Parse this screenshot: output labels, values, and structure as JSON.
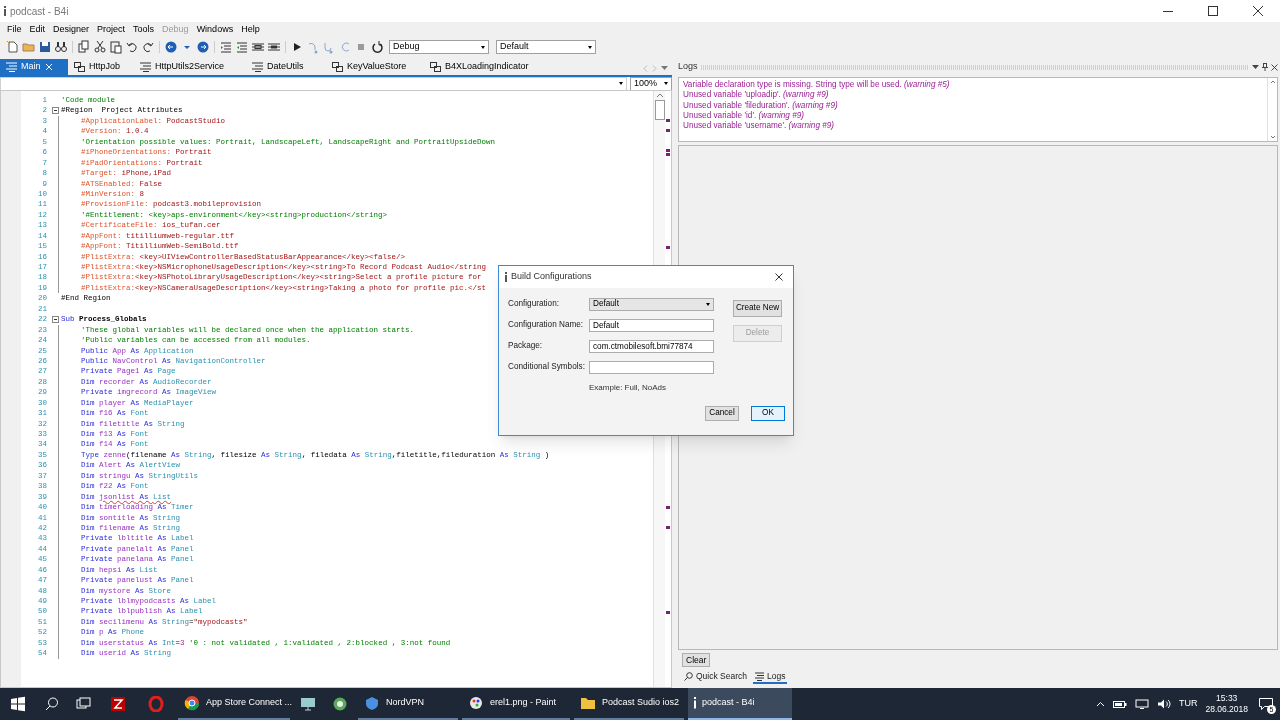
{
  "window": {
    "title": "podcast - B4i"
  },
  "menu": [
    {
      "label": "File",
      "disabled": false
    },
    {
      "label": "Edit",
      "disabled": false
    },
    {
      "label": "Designer",
      "disabled": false
    },
    {
      "label": "Project",
      "disabled": false
    },
    {
      "label": "Tools",
      "disabled": false
    },
    {
      "label": "Debug",
      "disabled": true
    },
    {
      "label": "Windows",
      "disabled": false
    },
    {
      "label": "Help",
      "disabled": false
    }
  ],
  "toolbar": {
    "build_mode": "Debug",
    "configuration": "Default"
  },
  "tabs": [
    {
      "label": "Main",
      "kind": "module",
      "selected": true
    },
    {
      "label": "HttpJob",
      "kind": "class",
      "selected": false
    },
    {
      "label": "HttpUtils2Service",
      "kind": "module",
      "selected": false
    },
    {
      "label": "DateUtils",
      "kind": "module",
      "selected": false
    },
    {
      "label": "KeyValueStore",
      "kind": "class",
      "selected": false
    },
    {
      "label": "B4XLoadingIndicator",
      "kind": "class",
      "selected": false
    }
  ],
  "editor": {
    "zoom": "100%",
    "lines": [
      {
        "number": "1",
        "tokens": [
          {
            "kind": "comment",
            "text": "'Code module"
          }
        ]
      },
      {
        "number": "2",
        "tokens": [
          {
            "kind": "plain",
            "text": "#Region  Project Attributes"
          }
        ],
        "children": [
          {
            "number": "3",
            "tokens": [
              {
                "kind": "directive",
                "text": "#ApplicationLabel:"
              },
              {
                "kind": "value",
                "text": " PodcastStudio"
              }
            ]
          },
          {
            "number": "4",
            "tokens": [
              {
                "kind": "directive",
                "text": "#Version:"
              },
              {
                "kind": "value",
                "text": " 1.0.4"
              }
            ]
          },
          {
            "number": "5",
            "tokens": [
              {
                "kind": "comment",
                "text": "'Orientation possible values: Portrait, LandscapeLeft, LandscapeRight and PortraitUpsideDown"
              }
            ]
          },
          {
            "number": "6",
            "tokens": [
              {
                "kind": "directive",
                "text": "#iPhoneOrientations:"
              },
              {
                "kind": "value",
                "text": " Portrait"
              }
            ]
          },
          {
            "number": "7",
            "tokens": [
              {
                "kind": "directive",
                "text": "#iPadOrientations:"
              },
              {
                "kind": "value",
                "text": " Portrait"
              }
            ]
          },
          {
            "number": "8",
            "tokens": [
              {
                "kind": "directive",
                "text": "#Target:"
              },
              {
                "kind": "value",
                "text": " iPhone,iPad"
              }
            ]
          },
          {
            "number": "9",
            "tokens": [
              {
                "kind": "directive",
                "text": "#ATSEnabled:"
              },
              {
                "kind": "value",
                "text": " False"
              }
            ]
          },
          {
            "number": "10",
            "tokens": [
              {
                "kind": "directive",
                "text": "#MinVersion:"
              },
              {
                "kind": "value",
                "text": " 8"
              }
            ]
          },
          {
            "number": "11",
            "tokens": [
              {
                "kind": "directive",
                "text": "#ProvisionFile:"
              },
              {
                "kind": "value",
                "text": " podcast3.mobileprovision"
              }
            ]
          },
          {
            "number": "12",
            "tokens": [
              {
                "kind": "comment",
                "text": "'#Entitlement: <key>aps-environment</key><string>production</string>"
              }
            ]
          },
          {
            "number": "13",
            "tokens": [
              {
                "kind": "directive",
                "text": "#CertificateFile:"
              },
              {
                "kind": "value",
                "text": " ios_tufan.cer"
              }
            ]
          },
          {
            "number": "14",
            "tokens": [
              {
                "kind": "directive",
                "text": "#AppFont:"
              },
              {
                "kind": "value",
                "text": " titilliumweb-regular.ttf"
              }
            ]
          },
          {
            "number": "15",
            "tokens": [
              {
                "kind": "directive",
                "text": "#AppFont:"
              },
              {
                "kind": "value",
                "text": " TitilliumWeb-SemiBold.ttf"
              }
            ]
          },
          {
            "number": "16",
            "tokens": [
              {
                "kind": "directive",
                "text": "#PlistExtra:"
              },
              {
                "kind": "value",
                "text": " <key>UIViewControllerBasedStatusBarAppearance</key><false/>"
              }
            ]
          },
          {
            "number": "17",
            "tokens": [
              {
                "kind": "directive",
                "text": "#PlistExtra:"
              },
              {
                "kind": "value",
                "text": "<key>NSMicrophoneUsageDescription</key><string>To Record Podcast Audio</string"
              }
            ]
          },
          {
            "number": "18",
            "tokens": [
              {
                "kind": "directive",
                "text": "#PlistExtra:"
              },
              {
                "kind": "value",
                "text": "<key>NSPhotoLibraryUsageDescription</key><string>Select a profile picture for"
              }
            ]
          },
          {
            "number": "19",
            "tokens": [
              {
                "kind": "directive",
                "text": "#PlistExtra:"
              },
              {
                "kind": "value",
                "text": "<key>NSCameraUsageDescription</key><string>Taking a photo for profile pic.</st"
              }
            ]
          }
        ]
      },
      {
        "number": "20",
        "tokens": [
          {
            "kind": "plain",
            "text": "#End Region"
          }
        ]
      },
      {
        "number": "21"
      },
      {
        "number": "22",
        "tokens": [
          {
            "kind": "keyword",
            "text": "Sub "
          },
          {
            "kind": "bold",
            "text": "Process_Globals"
          }
        ],
        "children": [
          {
            "number": "23",
            "tokens": [
              {
                "kind": "comment",
                "text": "'These global variables will be declared once when the application starts."
              }
            ]
          },
          {
            "number": "24",
            "tokens": [
              {
                "kind": "comment",
                "text": "'Public variables can be accessed from all modules."
              }
            ]
          },
          {
            "number": "25",
            "tokens": [
              {
                "kind": "keyword",
                "text": "Public "
              },
              {
                "kind": "name",
                "text": "App"
              },
              {
                "kind": "keyword",
                "text": " As "
              },
              {
                "kind": "type",
                "text": "Application"
              }
            ]
          },
          {
            "number": "26",
            "tokens": [
              {
                "kind": "keyword",
                "text": "Public "
              },
              {
                "kind": "name",
                "text": "NavControl"
              },
              {
                "kind": "keyword",
                "text": " As "
              },
              {
                "kind": "type",
                "text": "NavigationController"
              }
            ]
          },
          {
            "number": "27",
            "tokens": [
              {
                "kind": "keyword",
                "text": "Private "
              },
              {
                "kind": "name",
                "text": "Page1"
              },
              {
                "kind": "keyword",
                "text": " As "
              },
              {
                "kind": "type",
                "text": "Page"
              }
            ]
          },
          {
            "number": "28",
            "tokens": [
              {
                "kind": "keyword",
                "text": "Dim "
              },
              {
                "kind": "name",
                "text": "recorder"
              },
              {
                "kind": "keyword",
                "text": " As "
              },
              {
                "kind": "type",
                "text": "AudioRecorder"
              }
            ]
          },
          {
            "number": "29",
            "tokens": [
              {
                "kind": "keyword",
                "text": "Private "
              },
              {
                "kind": "name",
                "text": "imgrecord"
              },
              {
                "kind": "keyword",
                "text": " As "
              },
              {
                "kind": "type",
                "text": "ImageView"
              }
            ]
          },
          {
            "number": "30",
            "tokens": [
              {
                "kind": "keyword",
                "text": "Dim "
              },
              {
                "kind": "name",
                "text": "player"
              },
              {
                "kind": "keyword",
                "text": " As "
              },
              {
                "kind": "type",
                "text": "MediaPlayer"
              }
            ]
          },
          {
            "number": "31",
            "tokens": [
              {
                "kind": "keyword",
                "text": "Dim "
              },
              {
                "kind": "name",
                "text": "f16"
              },
              {
                "kind": "keyword",
                "text": " As "
              },
              {
                "kind": "type",
                "text": "Font"
              }
            ]
          },
          {
            "number": "32",
            "tokens": [
              {
                "kind": "keyword",
                "text": "Dim "
              },
              {
                "kind": "name",
                "text": "filetitle"
              },
              {
                "kind": "keyword",
                "text": " As "
              },
              {
                "kind": "type",
                "text": "String"
              }
            ]
          },
          {
            "number": "33",
            "tokens": [
              {
                "kind": "keyword",
                "text": "Dim "
              },
              {
                "kind": "name",
                "text": "f13"
              },
              {
                "kind": "keyword",
                "text": " As "
              },
              {
                "kind": "type",
                "text": "Font"
              }
            ]
          },
          {
            "number": "34",
            "tokens": [
              {
                "kind": "keyword",
                "text": "Dim "
              },
              {
                "kind": "name",
                "text": "f14"
              },
              {
                "kind": "keyword",
                "text": " As "
              },
              {
                "kind": "type",
                "text": "Font"
              }
            ]
          },
          {
            "number": "35",
            "tokens": [
              {
                "kind": "keyword",
                "text": "Type "
              },
              {
                "kind": "name",
                "text": "zenne"
              },
              {
                "kind": "plain",
                "text": "(filename"
              },
              {
                "kind": "keyword",
                "text": " As "
              },
              {
                "kind": "type",
                "text": "String"
              },
              {
                "kind": "plain",
                "text": ", filesize"
              },
              {
                "kind": "keyword",
                "text": " As "
              },
              {
                "kind": "type",
                "text": "String"
              },
              {
                "kind": "plain",
                "text": ", filedata"
              },
              {
                "kind": "keyword",
                "text": " As "
              },
              {
                "kind": "type",
                "text": "String"
              },
              {
                "kind": "plain",
                "text": ",filetitle,fileduration"
              },
              {
                "kind": "keyword",
                "text": " As "
              },
              {
                "kind": "type",
                "text": "String"
              },
              {
                "kind": "plain",
                "text": " )"
              }
            ]
          },
          {
            "number": "36",
            "tokens": [
              {
                "kind": "keyword",
                "text": "Dim "
              },
              {
                "kind": "name",
                "text": "Alert"
              },
              {
                "kind": "keyword",
                "text": " As "
              },
              {
                "kind": "type",
                "text": "AlertView"
              }
            ]
          },
          {
            "number": "37",
            "tokens": [
              {
                "kind": "keyword",
                "text": "Dim "
              },
              {
                "kind": "name",
                "text": "stringu"
              },
              {
                "kind": "keyword",
                "text": " As "
              },
              {
                "kind": "type",
                "text": "StringUtils"
              }
            ]
          },
          {
            "number": "38",
            "tokens": [
              {
                "kind": "keyword",
                "text": "Dim "
              },
              {
                "kind": "name",
                "text": "f22"
              },
              {
                "kind": "keyword",
                "text": " As "
              },
              {
                "kind": "type",
                "text": "Font"
              }
            ]
          },
          {
            "number": "39",
            "warning": true,
            "tokens": [
              {
                "kind": "keyword",
                "text": "Dim "
              },
              {
                "kind": "name",
                "text": "jsonlist"
              },
              {
                "kind": "keyword",
                "text": " As "
              },
              {
                "kind": "type",
                "text": "List"
              }
            ]
          },
          {
            "number": "40",
            "tokens": [
              {
                "kind": "keyword",
                "text": "Dim "
              },
              {
                "kind": "name",
                "text": "timerloading"
              },
              {
                "kind": "keyword",
                "text": " As "
              },
              {
                "kind": "type",
                "text": "Timer"
              }
            ]
          },
          {
            "number": "41",
            "tokens": [
              {
                "kind": "keyword",
                "text": "Dim "
              },
              {
                "kind": "name",
                "text": "sontitle"
              },
              {
                "kind": "keyword",
                "text": " As "
              },
              {
                "kind": "type",
                "text": "String"
              }
            ]
          },
          {
            "number": "42",
            "tokens": [
              {
                "kind": "keyword",
                "text": "Dim "
              },
              {
                "kind": "name",
                "text": "filename"
              },
              {
                "kind": "keyword",
                "text": " As "
              },
              {
                "kind": "type",
                "text": "String"
              }
            ]
          },
          {
            "number": "43",
            "tokens": [
              {
                "kind": "keyword",
                "text": "Private "
              },
              {
                "kind": "name",
                "text": "lbltitle"
              },
              {
                "kind": "keyword",
                "text": " As "
              },
              {
                "kind": "type",
                "text": "Label"
              }
            ]
          },
          {
            "number": "44",
            "tokens": [
              {
                "kind": "keyword",
                "text": "Private "
              },
              {
                "kind": "name",
                "text": "panelalt"
              },
              {
                "kind": "keyword",
                "text": " As "
              },
              {
                "kind": "type",
                "text": "Panel"
              }
            ]
          },
          {
            "number": "45",
            "tokens": [
              {
                "kind": "keyword",
                "text": "Private "
              },
              {
                "kind": "name",
                "text": "panelana"
              },
              {
                "kind": "keyword",
                "text": " As "
              },
              {
                "kind": "type",
                "text": "Panel"
              }
            ]
          },
          {
            "number": "46",
            "tokens": [
              {
                "kind": "keyword",
                "text": "Dim "
              },
              {
                "kind": "name",
                "text": "hepsi"
              },
              {
                "kind": "keyword",
                "text": " As "
              },
              {
                "kind": "type",
                "text": "List"
              }
            ]
          },
          {
            "number": "47",
            "tokens": [
              {
                "kind": "keyword",
                "text": "Private "
              },
              {
                "kind": "name",
                "text": "panelust"
              },
              {
                "kind": "keyword",
                "text": " As "
              },
              {
                "kind": "type",
                "text": "Panel"
              }
            ]
          },
          {
            "number": "48",
            "tokens": [
              {
                "kind": "keyword",
                "text": "Dim "
              },
              {
                "kind": "name",
                "text": "mystore"
              },
              {
                "kind": "keyword",
                "text": " As "
              },
              {
                "kind": "type",
                "text": "Store"
              }
            ]
          },
          {
            "number": "49",
            "tokens": [
              {
                "kind": "keyword",
                "text": "Private "
              },
              {
                "kind": "name",
                "text": "lblmypodcasts"
              },
              {
                "kind": "keyword",
                "text": " As "
              },
              {
                "kind": "type",
                "text": "Label"
              }
            ]
          },
          {
            "number": "50",
            "tokens": [
              {
                "kind": "keyword",
                "text": "Private "
              },
              {
                "kind": "name",
                "text": "lblpublish"
              },
              {
                "kind": "keyword",
                "text": " As "
              },
              {
                "kind": "type",
                "text": "Label"
              }
            ]
          },
          {
            "number": "51",
            "tokens": [
              {
                "kind": "keyword",
                "text": "Dim "
              },
              {
                "kind": "name",
                "text": "secilimenu"
              },
              {
                "kind": "keyword",
                "text": " As "
              },
              {
                "kind": "type",
                "text": "String"
              },
              {
                "kind": "plain",
                "text": "="
              },
              {
                "kind": "string",
                "text": "\"mypodcasts\""
              }
            ]
          },
          {
            "number": "52",
            "tokens": [
              {
                "kind": "keyword",
                "text": "Dim "
              },
              {
                "kind": "name",
                "text": "p"
              },
              {
                "kind": "keyword",
                "text": " As "
              },
              {
                "kind": "type",
                "text": "Phone"
              }
            ]
          },
          {
            "number": "53",
            "tokens": [
              {
                "kind": "keyword",
                "text": "Dim "
              },
              {
                "kind": "name",
                "text": "userstatus"
              },
              {
                "kind": "keyword",
                "text": " As "
              },
              {
                "kind": "type",
                "text": "Int"
              },
              {
                "kind": "plain",
                "text": "="
              },
              {
                "kind": "number",
                "text": "3"
              },
              {
                "kind": "comment",
                "text": " '0 : not validated , 1:validated , 2:blocked , 3:not found"
              }
            ]
          },
          {
            "number": "54",
            "tokens": [
              {
                "kind": "keyword",
                "text": "Dim "
              },
              {
                "kind": "name",
                "text": "userid"
              },
              {
                "kind": "keyword",
                "text": " As "
              },
              {
                "kind": "type",
                "text": "String"
              }
            ]
          }
        ]
      }
    ]
  },
  "dialog": {
    "title": "Build Configurations",
    "fields": [
      {
        "label": "Configuration:",
        "kind": "select",
        "value": "Default"
      },
      {
        "label": "Configuration Name:",
        "kind": "text",
        "value": "Default"
      },
      {
        "label": "Package:",
        "kind": "text",
        "value": "com.ctmobilesoft.bmi77874"
      },
      {
        "label": "Conditional Symbols:",
        "kind": "text"
      }
    ],
    "hint": "Example: Full, NoAds",
    "side_buttons": [
      {
        "label": "Create New",
        "disabled": false
      },
      {
        "label": "Delete",
        "disabled": true
      }
    ],
    "buttons": [
      {
        "label": "Cancel",
        "default": false
      },
      {
        "label": "OK",
        "default": true
      }
    ]
  },
  "logs": {
    "title": "Logs",
    "messages": [
      {
        "text": "Variable declaration type is missing. String type will be used.",
        "code": "(warning #5)"
      },
      {
        "text": "Unused variable 'uploadip'.",
        "code": "(warning #9)"
      },
      {
        "text": "Unused variable 'fileduration'.",
        "code": "(warning #9)"
      },
      {
        "text": "Unused variable 'id'.",
        "code": "(warning #9)"
      },
      {
        "text": "Unused variable 'username'.",
        "code": "(warning #9)"
      }
    ],
    "clear_button": "Clear",
    "tabs": [
      {
        "label": "Quick Search",
        "selected": false
      },
      {
        "label": "Logs",
        "selected": true
      }
    ]
  },
  "taskbar": {
    "items": [
      {
        "label": "App Store Connect ...",
        "active": false
      },
      {
        "label": "NordVPN",
        "active": false
      },
      {
        "label": "erel1.png - Paint",
        "active": false
      },
      {
        "label": "Podcast Sudio ios2",
        "active": false
      },
      {
        "label": "podcast - B4i",
        "active": true
      }
    ],
    "language": "TUR",
    "time": "15:33",
    "date": "28.06.2018",
    "notifications": "5"
  }
}
